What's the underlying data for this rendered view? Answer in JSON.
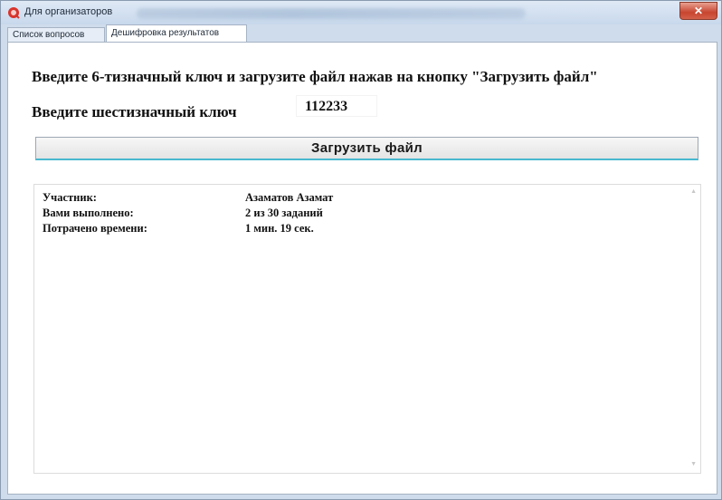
{
  "window": {
    "title": "Для организаторов",
    "close_glyph": "✕"
  },
  "tabs": [
    {
      "label": "Список вопросов",
      "active": false
    },
    {
      "label": "Дешифровка результатов",
      "active": true
    }
  ],
  "main": {
    "instruction": "Введите 6-тизначный ключ и загрузите файл нажав на кнопку \"Загрузить файл\"",
    "key_label": "Введите шестизначный ключ",
    "key_value": "112233",
    "load_button_label": "Загрузить файл"
  },
  "results": {
    "rows": [
      {
        "label": "Участник:",
        "value": "Азаматов Азамат"
      },
      {
        "label": "Вами выполнено:",
        "value": "2 из 30 заданий"
      },
      {
        "label": "Потрачено времени:",
        "value": "1 мин. 19 сек."
      }
    ],
    "scroll_up_glyph": "▲",
    "scroll_down_glyph": "▼"
  },
  "icons": {
    "app_icon": "app-logo-icon",
    "close_icon": "close-icon"
  },
  "colors": {
    "app_icon_red": "#d9342b",
    "button_focus_accent": "#49b8cf"
  }
}
